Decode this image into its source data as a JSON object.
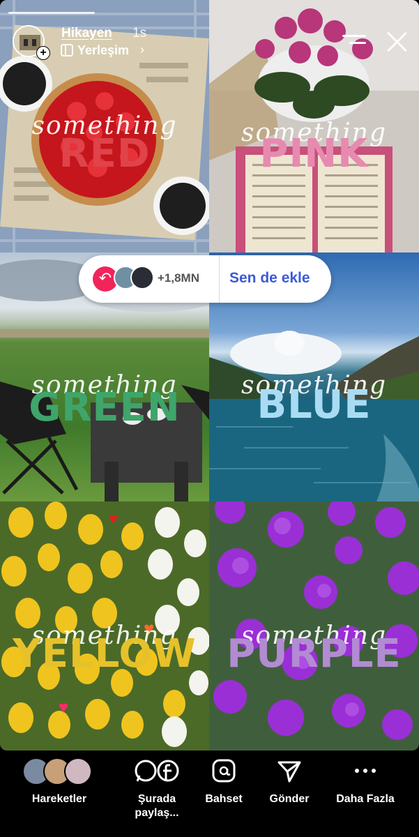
{
  "story": {
    "username": "Hikayen",
    "time": "1s",
    "location": "Yerleşim",
    "tiles": [
      {
        "script": "something",
        "word": "RED",
        "color": "#e0434a"
      },
      {
        "script": "something",
        "word": "PINK",
        "color": "#e78ab0"
      },
      {
        "script": "something",
        "word": "GREEN",
        "color": "#3fa56a"
      },
      {
        "script": "something",
        "word": "BLUE",
        "color": "#a9dcf3"
      },
      {
        "script": "something",
        "word": "YELLOW",
        "color": "#e6c12a"
      },
      {
        "script": "something",
        "word": "PURPLE",
        "color": "#b28bd3"
      }
    ]
  },
  "add_yours": {
    "count": "+1,8MN",
    "cta": "Sen de ekle"
  },
  "actions": [
    {
      "label": "Hareketler",
      "icon": "activity-avatars"
    },
    {
      "label": "Şurada paylaş...",
      "icon": "whatsapp-facebook-icon"
    },
    {
      "label": "Bahset",
      "icon": "mention-icon"
    },
    {
      "label": "Gönder",
      "icon": "send-icon"
    },
    {
      "label": "Daha Fazla",
      "icon": "more-icon"
    }
  ]
}
